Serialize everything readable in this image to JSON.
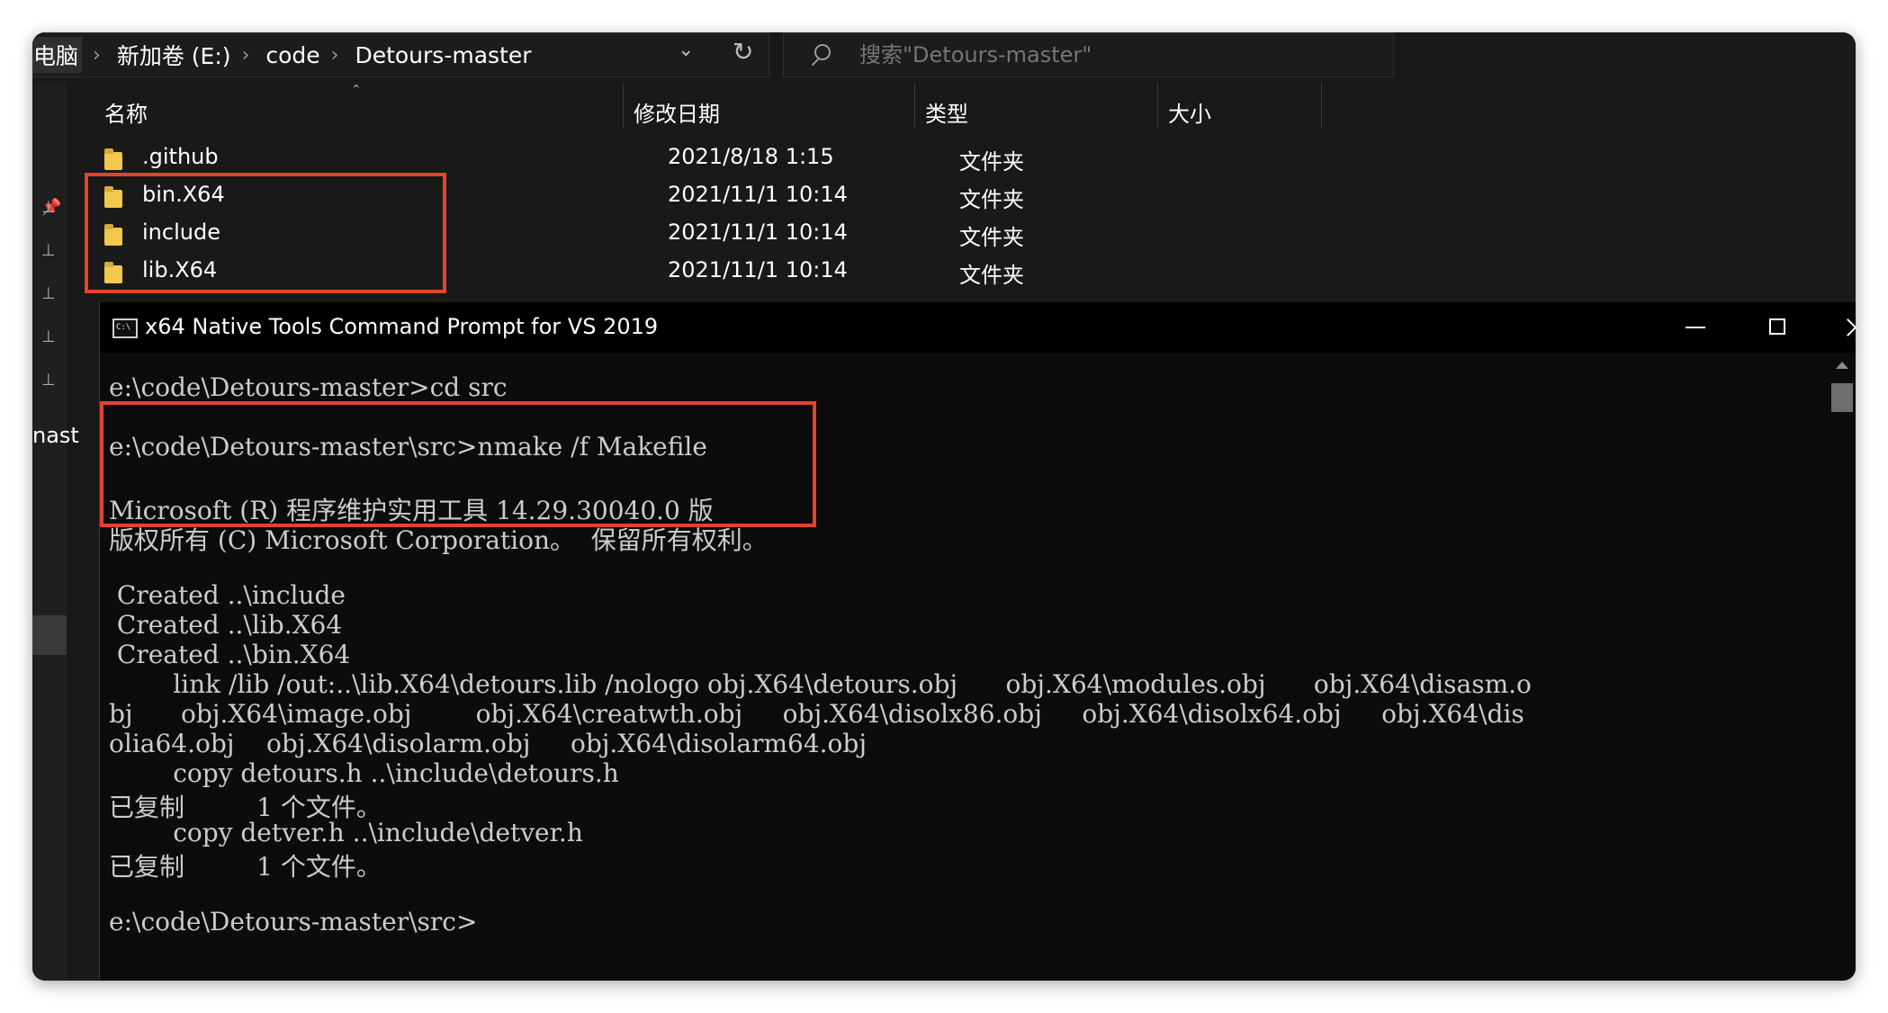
{
  "explorer": {
    "breadcrumb": [
      "电脑",
      "新加卷 (E:)",
      "code",
      "Detours-master"
    ],
    "search_placeholder": "搜索\"Detours-master\"",
    "columns": {
      "name": "名称",
      "date": "修改日期",
      "type": "类型",
      "size": "大小"
    },
    "files": [
      {
        "name": ".github",
        "date": "2021/8/18 1:15",
        "type": "文件夹"
      },
      {
        "name": "bin.X64",
        "date": "2021/11/1 10:14",
        "type": "文件夹"
      },
      {
        "name": "include",
        "date": "2021/11/1 10:14",
        "type": "文件夹"
      },
      {
        "name": "lib.X64",
        "date": "2021/11/1 10:14",
        "type": "文件夹"
      }
    ],
    "nav_partial_label": "nast"
  },
  "cmd": {
    "title": "x64 Native Tools Command Prompt for VS 2019",
    "icon_text": "C:\\",
    "lines": [
      "e:\\code\\Detours-master>cd src",
      "",
      "e:\\code\\Detours-master\\src>nmake /f Makefile",
      "",
      "Microsoft (R) 程序维护实用工具 14.29.30040.0 版",
      "版权所有 (C) Microsoft Corporation。  保留所有权利。",
      "",
      " Created ..\\include",
      " Created ..\\lib.X64",
      " Created ..\\bin.X64",
      "        link /lib /out:..\\lib.X64\\detours.lib /nologo obj.X64\\detours.obj      obj.X64\\modules.obj      obj.X64\\disasm.o",
      "bj      obj.X64\\image.obj        obj.X64\\creatwth.obj     obj.X64\\disolx86.obj     obj.X64\\disolx64.obj     obj.X64\\dis",
      "olia64.obj    obj.X64\\disolarm.obj     obj.X64\\disolarm64.obj",
      "        copy detours.h ..\\include\\detours.h",
      "已复制         1 个文件。",
      "        copy detver.h ..\\include\\detver.h",
      "已复制         1 个文件。",
      "",
      "e:\\code\\Detours-master\\src>"
    ]
  }
}
